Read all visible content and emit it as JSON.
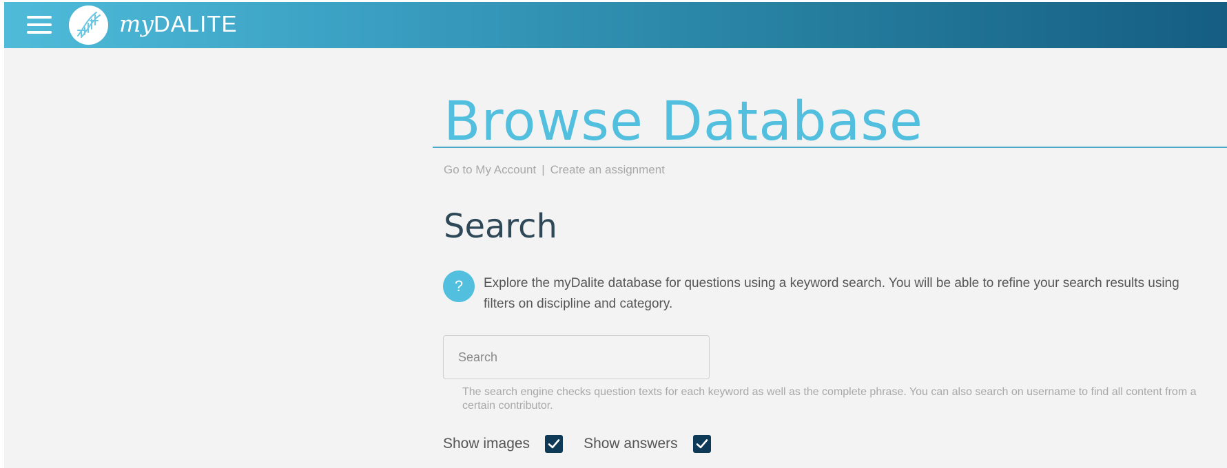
{
  "header": {
    "brand_my": "my",
    "brand_name": "DALITE"
  },
  "page": {
    "title": "Browse Database",
    "breadcrumb": {
      "account_link": "Go to My Account",
      "separator": "|",
      "assignment_link": "Create an assignment"
    }
  },
  "search": {
    "heading": "Search",
    "help_icon_glyph": "?",
    "help_text": "Explore the myDalite database for questions using a keyword search. You will be able to refine your search results using filters on discipline and category.",
    "input_placeholder": "Search",
    "input_value": "",
    "hint_text": "The search engine checks question texts for each keyword as well as the complete phrase. You can also search on username to find all content from a certain contributor.",
    "show_images_label": "Show images",
    "show_images_checked": true,
    "show_answers_label": "Show answers",
    "show_answers_checked": true
  },
  "colors": {
    "accent": "#53bfde",
    "header_start": "#4fbbd9",
    "header_end": "#155d83",
    "checkbox": "#0f3a57",
    "heading_dark": "#2f4858"
  },
  "icons": {
    "menu": "hamburger-menu-icon",
    "logo": "mydalite-logo-icon",
    "help": "question-mark-icon",
    "check": "checkmark-icon"
  }
}
